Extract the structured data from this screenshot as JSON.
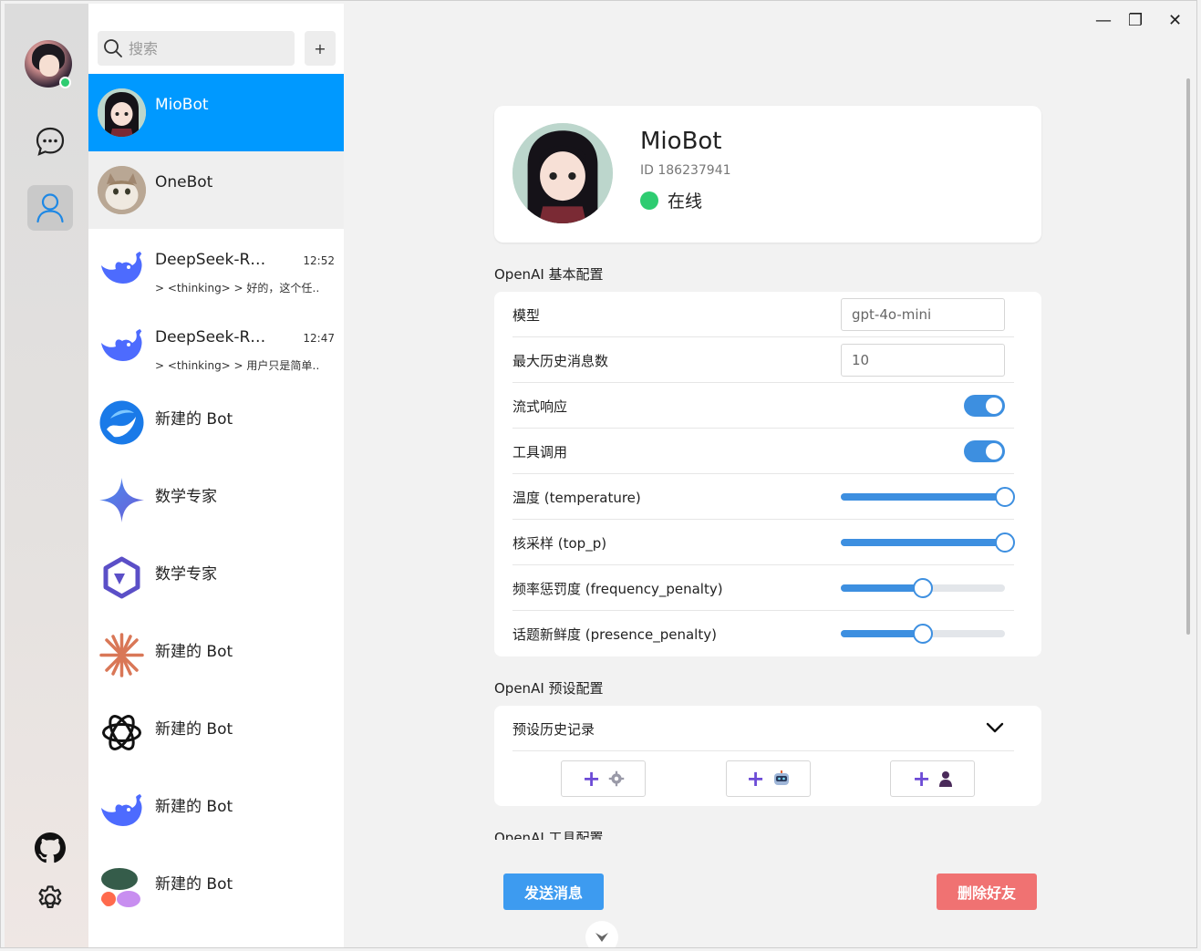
{
  "search": {
    "placeholder": "搜索",
    "add_label": "+"
  },
  "contacts": [
    {
      "name": "MioBot",
      "time": "",
      "preview": ""
    },
    {
      "name": "OneBot",
      "time": "",
      "preview": ""
    },
    {
      "name": "DeepSeek-R…",
      "time": "12:52",
      "preview": "> <thinking> > 好的，这个任…"
    },
    {
      "name": "DeepSeek-R…",
      "time": "12:47",
      "preview": "> <thinking> > 用户只是简单…"
    },
    {
      "name": "新建的 Bot",
      "time": "",
      "preview": ""
    },
    {
      "name": "数学专家",
      "time": "",
      "preview": ""
    },
    {
      "name": "数学专家",
      "time": "",
      "preview": ""
    },
    {
      "name": "新建的 Bot",
      "time": "",
      "preview": ""
    },
    {
      "name": "新建的 Bot",
      "time": "",
      "preview": ""
    },
    {
      "name": "新建的 Bot",
      "time": "",
      "preview": ""
    },
    {
      "name": "新建的 Bot",
      "time": "",
      "preview": ""
    }
  ],
  "window_controls": {
    "minimize": "—",
    "restore": "❐",
    "close": "✕"
  },
  "profile": {
    "name": "MioBot",
    "id": "ID 186237941",
    "status": "在线"
  },
  "basic_config": {
    "title": "OpenAI 基本配置",
    "model_label": "模型",
    "model_value": "gpt-4o-mini",
    "max_history_label": "最大历史消息数",
    "max_history_value": "10",
    "stream_label": "流式响应",
    "stream_on": true,
    "tools_label": "工具调用",
    "tools_on": true,
    "temperature_label": "温度 (temperature)",
    "temperature_level": 1.0,
    "top_p_label": "核采样 (top_p)",
    "top_p_level": 1.0,
    "frequency_label": "频率惩罚度 (frequency_penalty)",
    "frequency_level": 0.5,
    "presence_label": "话题新鲜度 (presence_penalty)",
    "presence_level": 0.5
  },
  "preset_config": {
    "title": "OpenAI 预设配置",
    "history_label": "预设历史记录",
    "buttons": [
      {
        "plus": "+",
        "icon": "gear-icon"
      },
      {
        "plus": "+",
        "icon": "robot-icon"
      },
      {
        "plus": "+",
        "icon": "user-icon"
      }
    ]
  },
  "tool_config": {
    "title": "OpenAI 工具配置"
  },
  "actions": {
    "send": "发送消息",
    "delete": "删除好友"
  },
  "colors": {
    "accent": "#0099ff",
    "online": "#2ecc71",
    "danger": "#f07272",
    "toggle": "#3d8fe0"
  }
}
